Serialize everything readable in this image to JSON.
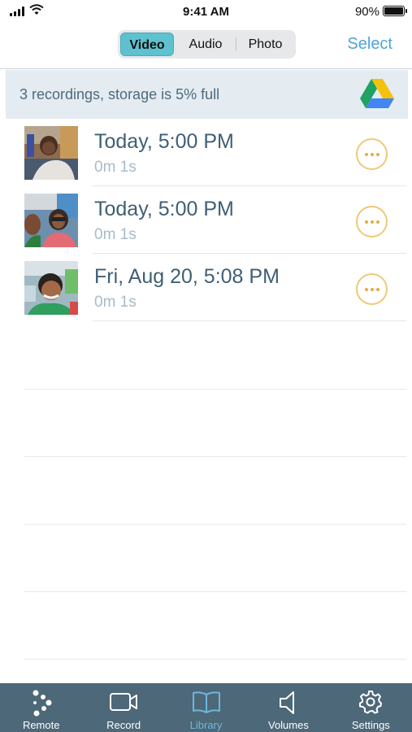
{
  "status_bar": {
    "time": "9:41 AM",
    "battery": "90%"
  },
  "nav": {
    "segments": [
      {
        "label": "Video",
        "active": true
      },
      {
        "label": "Audio",
        "active": false
      },
      {
        "label": "Photo",
        "active": false
      }
    ],
    "select_label": "Select"
  },
  "banner": {
    "text": "3 recordings, storage is 5% full",
    "icon": "google-drive-icon"
  },
  "recordings": [
    {
      "title": "Today, 5:00 PM",
      "duration": "0m 1s"
    },
    {
      "title": "Today, 5:00 PM",
      "duration": "0m 1s"
    },
    {
      "title": "Fri, Aug 20, 5:08 PM",
      "duration": "0m 1s"
    }
  ],
  "tabs": [
    {
      "label": "Remote",
      "icon": "remote-icon",
      "active": false
    },
    {
      "label": "Record",
      "icon": "video-camera-icon",
      "active": false
    },
    {
      "label": "Library",
      "icon": "book-icon",
      "active": true
    },
    {
      "label": "Volumes",
      "icon": "speaker-icon",
      "active": false
    },
    {
      "label": "Settings",
      "icon": "gear-icon",
      "active": false
    }
  ],
  "colors": {
    "accent": "#5ec1cf",
    "link": "#4fa3d8",
    "tab_bar": "#4d6878",
    "more_button": "#e4ac43"
  }
}
